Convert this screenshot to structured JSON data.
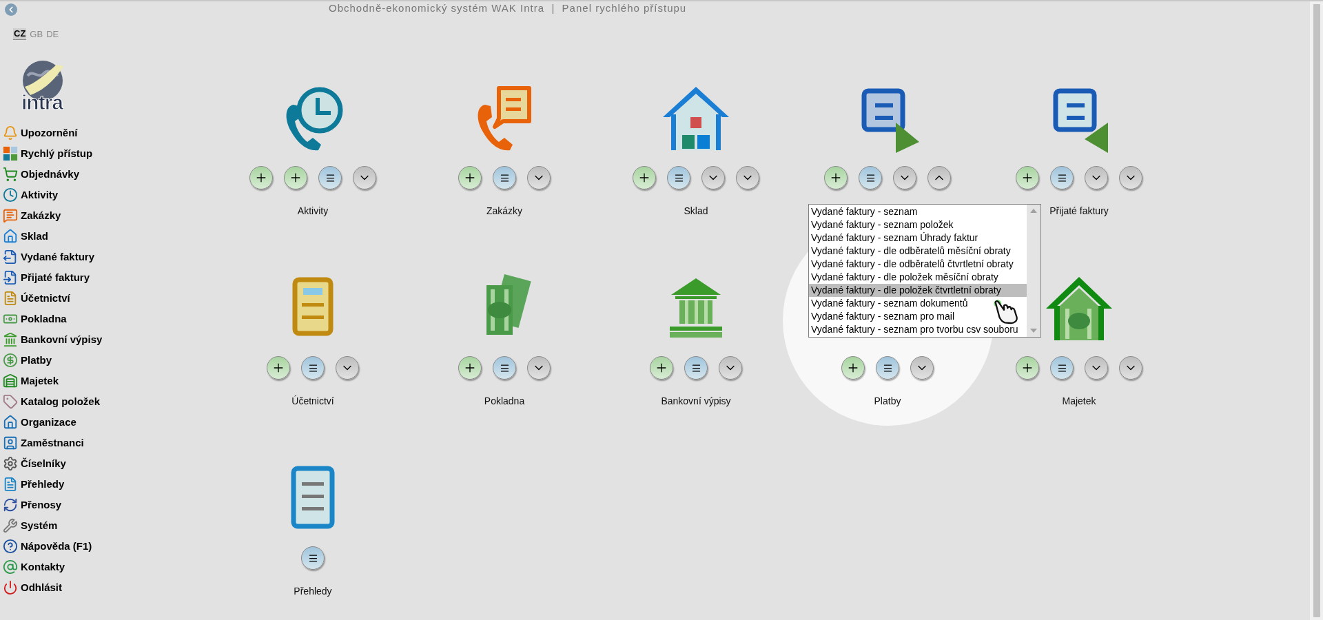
{
  "header": {
    "title": "Obchodně-ekonomický systém WAK Intra  |  Panel rychlého přístupu"
  },
  "languages": [
    {
      "label": "CZ",
      "selected": true
    },
    {
      "label": "GB",
      "selected": false
    },
    {
      "label": "DE",
      "selected": false
    }
  ],
  "logo": {
    "text": "intra"
  },
  "sidebar": {
    "items": [
      {
        "label": "Upozornění"
      },
      {
        "label": "Rychlý přístup"
      },
      {
        "label": "Objednávky"
      },
      {
        "label": "Aktivity"
      },
      {
        "label": "Zakázky"
      },
      {
        "label": "Sklad"
      },
      {
        "label": "Vydané faktury"
      },
      {
        "label": "Přijaté faktury"
      },
      {
        "label": "Účetnictví"
      },
      {
        "label": "Pokladna"
      },
      {
        "label": "Bankovní výpisy"
      },
      {
        "label": "Platby"
      },
      {
        "label": "Majetek"
      },
      {
        "label": "Katalog položek"
      },
      {
        "label": "Organizace"
      },
      {
        "label": "Zaměstnanci"
      },
      {
        "label": "Číselníky"
      },
      {
        "label": "Přehledy"
      },
      {
        "label": "Přenosy"
      },
      {
        "label": "Systém"
      },
      {
        "label": "Nápověda (F1)"
      },
      {
        "label": "Kontakty"
      },
      {
        "label": "Odhlásit"
      }
    ]
  },
  "tiles": [
    {
      "label": "Aktivity",
      "buttons": [
        {
          "kind": "add"
        },
        {
          "kind": "add"
        },
        {
          "kind": "list"
        },
        {
          "kind": "menu",
          "expanded": false
        }
      ]
    },
    {
      "label": "Zakázky",
      "buttons": [
        {
          "kind": "add"
        },
        {
          "kind": "list"
        },
        {
          "kind": "menu",
          "expanded": false
        }
      ]
    },
    {
      "label": "Sklad",
      "buttons": [
        {
          "kind": "add"
        },
        {
          "kind": "list"
        },
        {
          "kind": "menu",
          "expanded": false
        },
        {
          "kind": "menu",
          "expanded": false
        }
      ]
    },
    {
      "buttons": [
        {
          "kind": "add"
        },
        {
          "kind": "list"
        },
        {
          "kind": "menu",
          "expanded": false
        },
        {
          "kind": "menu",
          "expanded": true
        }
      ],
      "dropdown": {
        "items": [
          {
            "label": "Vydané faktury - seznam",
            "selected": false
          },
          {
            "label": "Vydané faktury - seznam položek",
            "selected": false
          },
          {
            "label": "Vydané faktury - seznam Úhrady faktur",
            "selected": false
          },
          {
            "label": "Vydané faktury - dle odběratelů měsíční obraty",
            "selected": false
          },
          {
            "label": "Vydané faktury - dle odběratelů čtvrtletní obraty",
            "selected": false
          },
          {
            "label": "Vydané faktury - dle položek měsíční obraty",
            "selected": false
          },
          {
            "label": "Vydané faktury - dle položek čtvrtletní obraty",
            "selected": true
          },
          {
            "label": "Vydané faktury - seznam dokumentů",
            "selected": false
          },
          {
            "label": "Vydané faktury - seznam pro mail",
            "selected": false
          },
          {
            "label": "Vydané faktury - seznam pro tvorbu csv souboru",
            "selected": false
          }
        ]
      }
    },
    {
      "label": "Přijaté faktury",
      "buttons": [
        {
          "kind": "add"
        },
        {
          "kind": "list"
        },
        {
          "kind": "menu",
          "expanded": false
        },
        {
          "kind": "menu",
          "expanded": false
        }
      ]
    },
    {
      "label": "Účetnictví",
      "buttons": [
        {
          "kind": "add"
        },
        {
          "kind": "list"
        },
        {
          "kind": "menu",
          "expanded": false
        }
      ]
    },
    {
      "label": "Pokladna",
      "buttons": [
        {
          "kind": "add"
        },
        {
          "kind": "list"
        },
        {
          "kind": "menu",
          "expanded": false
        }
      ]
    },
    {
      "label": "Bankovní výpisy",
      "buttons": [
        {
          "kind": "add"
        },
        {
          "kind": "list"
        },
        {
          "kind": "menu",
          "expanded": false
        }
      ]
    },
    {
      "label": "Platby",
      "buttons": [
        {
          "kind": "add"
        },
        {
          "kind": "list"
        },
        {
          "kind": "menu",
          "expanded": false
        }
      ]
    },
    {
      "label": "Majetek",
      "buttons": [
        {
          "kind": "add"
        },
        {
          "kind": "list"
        },
        {
          "kind": "menu",
          "expanded": false
        },
        {
          "kind": "menu",
          "expanded": false
        }
      ]
    },
    {
      "label": "Přehledy",
      "buttons": [
        {
          "kind": "list"
        }
      ]
    }
  ]
}
